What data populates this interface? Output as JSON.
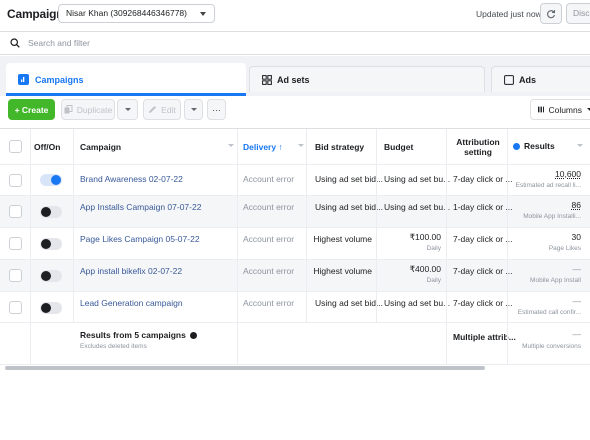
{
  "header": {
    "title": "Campaigns",
    "account": "Nisar Khan (309268446346778)",
    "updated": "Updated just now",
    "discard_label": "Disca"
  },
  "search": {
    "placeholder": "Search and filter"
  },
  "tabs": [
    {
      "label": "Campaigns",
      "active": true
    },
    {
      "label": "Ad sets",
      "active": false
    },
    {
      "label": "Ads",
      "active": false
    }
  ],
  "toolbar": {
    "create_label": "+ Create",
    "duplicate_label": "Duplicate",
    "edit_label": "Edit",
    "more_label": "···",
    "columns_label": "Columns"
  },
  "table": {
    "headers": {
      "onoff": "Off/On",
      "campaign": "Campaign",
      "delivery": "Delivery ↑",
      "bid": "Bid strategy",
      "budget": "Budget",
      "attribution_1": "Attribution",
      "attribution_2": "setting",
      "results": "Results"
    },
    "rows": [
      {
        "on": true,
        "campaign": "Brand Awareness 02-07-22",
        "delivery": "Account error",
        "bid": "Using ad set bid...",
        "budget": "Using ad set bu...",
        "budget_sub": "",
        "attribution": "7-day click or ...",
        "results": "10,600",
        "results_sub": "Estimated ad recall li..."
      },
      {
        "on": false,
        "campaign": "App Installs Campaign 07-07-22",
        "delivery": "Account error",
        "bid": "Using ad set bid...",
        "budget": "Using ad set bu...",
        "budget_sub": "",
        "attribution": "1-day click or ...",
        "results": "86",
        "results_sub": "Mobile App Installi..."
      },
      {
        "on": false,
        "campaign": "Page Likes Campaign 05-07-22",
        "delivery": "Account error",
        "bid": "Highest volume",
        "budget": "₹100.00",
        "budget_sub": "Daily",
        "attribution": "7-day click or ...",
        "results": "30",
        "results_sub": "Page Likes"
      },
      {
        "on": false,
        "campaign": "App install bikefix 02-07-22",
        "delivery": "Account error",
        "bid": "Highest volume",
        "budget": "₹400.00",
        "budget_sub": "Daily",
        "attribution": "7-day click or ...",
        "results": "—",
        "results_sub": "Mobile App Install"
      },
      {
        "on": false,
        "campaign": "Lead Generation campaign",
        "delivery": "Account error",
        "bid": "Using ad set bid...",
        "budget": "Using ad set bu...",
        "budget_sub": "",
        "attribution": "7-day click or ...",
        "results": "—",
        "results_sub": "Estimated call confir..."
      }
    ],
    "footer": {
      "title": "Results from 5 campaigns",
      "subtitle": "Excludes deleted items",
      "attribution": "Multiple attrib...",
      "results_dash": "—",
      "results_sub": "Multiple conversions"
    }
  },
  "colors": {
    "accent": "#1877f2",
    "create": "#42b72a",
    "link": "#385898"
  }
}
